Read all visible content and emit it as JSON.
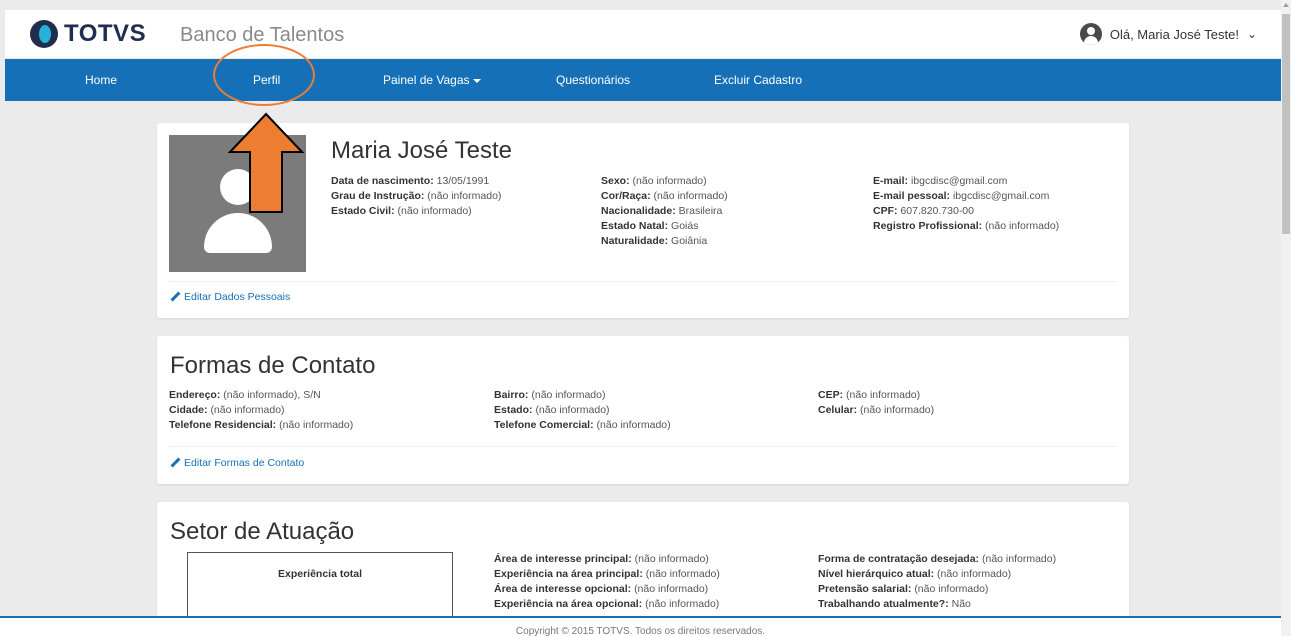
{
  "header": {
    "brand": "TOTVS",
    "app_title": "Banco de Talentos",
    "user_greeting": "Olá, Maria José Teste!"
  },
  "nav": {
    "home": "Home",
    "perfil": "Perfil",
    "painel_vagas": "Painel de Vagas",
    "questionarios": "Questionários",
    "excluir": "Excluir Cadastro"
  },
  "profile": {
    "name": "Maria José Teste",
    "col1": [
      {
        "label": "Data de nascimento:",
        "value": "13/05/1991"
      },
      {
        "label": "Grau de Instrução:",
        "value": "(não informado)"
      },
      {
        "label": "Estado Civil:",
        "value": "(não informado)"
      }
    ],
    "col2": [
      {
        "label": "Sexo:",
        "value": "(não informado)"
      },
      {
        "label": "Cor/Raça:",
        "value": "(não informado)"
      },
      {
        "label": "Nacionalidade:",
        "value": "Brasileira"
      },
      {
        "label": "Estado Natal:",
        "value": "Goiás"
      },
      {
        "label": "Naturalidade:",
        "value": "Goiânia"
      }
    ],
    "col3": [
      {
        "label": "E-mail:",
        "value": "ibgcdisc@gmail.com"
      },
      {
        "label": "E-mail pessoal:",
        "value": "ibgcdisc@gmail.com"
      },
      {
        "label": "CPF:",
        "value": "607.820.730-00"
      },
      {
        "label": "Registro Profissional:",
        "value": "(não informado)"
      }
    ],
    "edit_label": "Editar Dados Pessoais"
  },
  "contact": {
    "title": "Formas de Contato",
    "col1": [
      {
        "label": "Endereço:",
        "value": "(não informado), S/N"
      },
      {
        "label": "Cidade:",
        "value": "(não informado)"
      },
      {
        "label": "Telefone Residencial:",
        "value": "(não informado)"
      }
    ],
    "col2": [
      {
        "label": "Bairro:",
        "value": "(não informado)"
      },
      {
        "label": "Estado:",
        "value": "(não informado)"
      },
      {
        "label": "Telefone Comercial:",
        "value": "(não informado)"
      }
    ],
    "col3": [
      {
        "label": "CEP:",
        "value": "(não informado)"
      },
      {
        "label": "Celular:",
        "value": "(não informado)"
      }
    ],
    "edit_label": "Editar Formas de Contato"
  },
  "sector": {
    "title": "Setor de Atuação",
    "experience_title": "Experiência total",
    "col2": [
      {
        "label": "Área de interesse principal:",
        "value": "(não informado)"
      },
      {
        "label": "Experiência na área principal:",
        "value": "(não informado)"
      },
      {
        "label": "Área de interesse opcional:",
        "value": "(não informado)"
      },
      {
        "label": "Experiência na área opcional:",
        "value": "(não informado)"
      }
    ],
    "col3": [
      {
        "label": "Forma de contratação desejada:",
        "value": "(não informado)"
      },
      {
        "label": "Nível hierárquico atual:",
        "value": "(não informado)"
      },
      {
        "label": "Pretensão salarial:",
        "value": "(não informado)"
      },
      {
        "label": "Trabalhando atualmente?:",
        "value": "Não"
      }
    ]
  },
  "footer": {
    "copyright": "Copyright © 2015 TOTVS. Todos os direitos reservados."
  },
  "colors": {
    "nav_blue": "#1570b8",
    "annotation_orange": "#ec7d31",
    "page_bg": "#ebebeb"
  }
}
